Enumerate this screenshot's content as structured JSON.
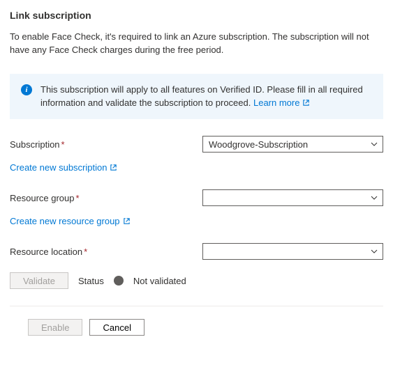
{
  "title": "Link subscription",
  "description": "To enable Face Check, it's required to link an Azure subscription. The subscription will not have any Face Check charges during the free period.",
  "infobox": {
    "text": "This subscription will apply to all features on Verified ID. Please fill in all required information and validate the subscription to proceed.",
    "learn_more": "Learn more"
  },
  "fields": {
    "subscription": {
      "label": "Subscription",
      "value": "Woodgrove-Subscription",
      "create_link": "Create new subscription"
    },
    "resource_group": {
      "label": "Resource group",
      "value": "",
      "create_link": "Create new resource group"
    },
    "resource_location": {
      "label": "Resource location",
      "value": ""
    }
  },
  "status": {
    "validate_button": "Validate",
    "status_label": "Status",
    "status_value": "Not validated"
  },
  "actions": {
    "enable": "Enable",
    "cancel": "Cancel"
  }
}
